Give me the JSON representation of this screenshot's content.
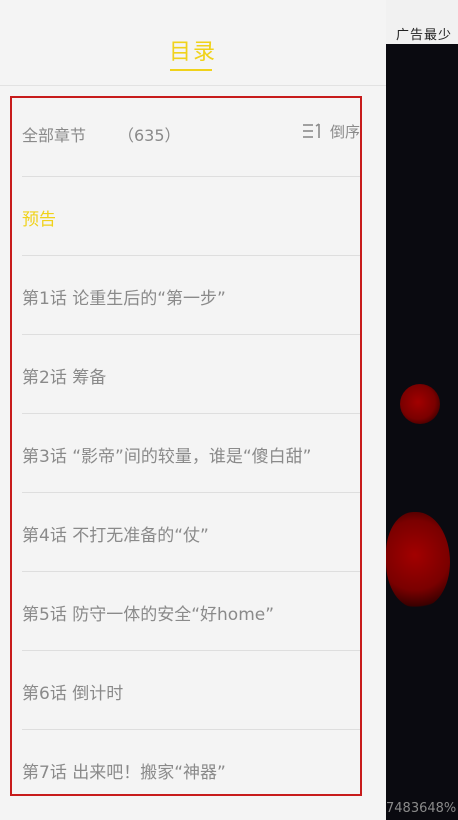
{
  "drawer": {
    "title": "目录"
  },
  "list_header": {
    "label": "全部章节",
    "count": "（635）",
    "sort_label": "倒序"
  },
  "chapters": [
    {
      "label": "预告",
      "active": true
    },
    {
      "label": "第1话 论重生后的“第一步”"
    },
    {
      "label": "第2话 筹备"
    },
    {
      "label": "第3话 “影帝”间的较量，谁是“傻白甜”"
    },
    {
      "label": "第4话 不打无准备的“仗”"
    },
    {
      "label": "第5话 防守一体的安全“好home”"
    },
    {
      "label": "第6话 倒计时"
    },
    {
      "label": "第7话 出来吧！搬家“神器”"
    }
  ],
  "background": {
    "ad_text": "广告最少",
    "footer_text": "7483648%"
  },
  "colors": {
    "accent": "#f0d21a",
    "highlight_border": "#c71b1b",
    "text_muted": "#8a8a8a",
    "drawer_bg": "#f4f4f4"
  }
}
